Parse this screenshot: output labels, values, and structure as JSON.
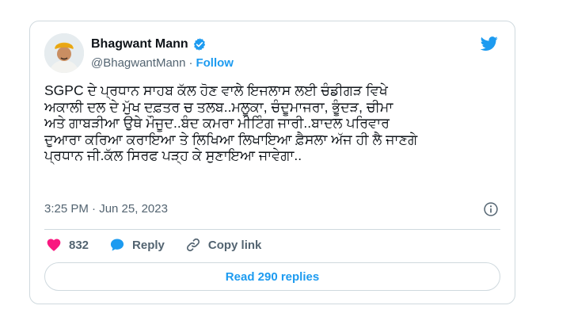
{
  "author": {
    "name": "Bhagwant Mann",
    "handle": "@BhagwantMann",
    "separator": "·",
    "follow_label": "Follow"
  },
  "tweet": {
    "text": "SGPC ਦੇ ਪ੍ਰਧਾਨ ਸਾਹਬ ਕੱਲ ਹੋਣ ਵਾਲੇ ਇਜਲਾਸ ਲਈ ਚੰਡੀਗੜ ਵਿਖੇ\nਅਕਾਲੀ ਦਲ ਦੇ ਮੁੱਖ ਦਫ਼ਤਰ ਚ ਤਲਬ..ਮਲੂਕਾ, ਚੰਦੂਮਾਜਰਾ, ਭੂੰਦੜ, ਚੀਮਾ\nਅਤੇ ਗਾਬੜੀਆ ਉਥੇ ਮੌਜੂਦ..ਬੰਦ ਕਮਰਾ ਮੀਟਿੰਗ ਜਾਰੀ..ਬਾਦਲ ਪਰਿਵਾਰ\nਦੁਆਰਾ ਕਰਿਆ ਕਰਾਇਆ ਤੇ ਲਿਖਿਆ ਲਿਖਾਇਆ ਫ਼ੈਸਲਾ ਅੱਜ ਹੀ ਲੈ ਜਾਣਗੇ\nਪ੍ਰਧਾਨ ਜੀ.ਕੱਲ ਸਿਰਫ ਪੜ੍ਹ ਕੇ ਸੁਣਾਇਆ ਜਾਵੇਗਾ..",
    "timestamp": "3:25 PM · Jun 25, 2023"
  },
  "actions": {
    "likes": "832",
    "reply_label": "Reply",
    "copy_link_label": "Copy link",
    "read_replies_label": "Read 290 replies"
  },
  "colors": {
    "accent": "#1d9bf0",
    "like": "#f91880",
    "border": "#cfd9de",
    "muted": "#536471"
  },
  "icons": [
    "avatar",
    "verified-icon",
    "twitter-bird-icon",
    "info-icon",
    "heart-icon",
    "reply-bubble-icon",
    "copy-link-icon"
  ]
}
